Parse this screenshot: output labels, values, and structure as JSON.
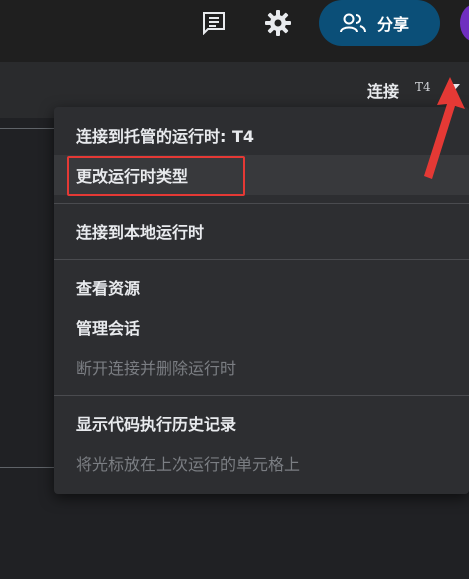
{
  "toolbar": {
    "comment_icon": "comment-icon",
    "settings_icon": "gear-icon",
    "share_label": "分享",
    "share_icon": "people-icon"
  },
  "runtime": {
    "connect_label": "连接",
    "runtime_type": "T4"
  },
  "menu": {
    "items": [
      {
        "label": "连接到托管的运行时: T4",
        "enabled": true
      },
      {
        "label": "更改运行时类型",
        "enabled": true,
        "highlighted": true
      },
      {
        "label": "连接到本地运行时",
        "enabled": true
      },
      {
        "label": "查看资源",
        "enabled": true
      },
      {
        "label": "管理会话",
        "enabled": true
      },
      {
        "label": "断开连接并删除运行时",
        "enabled": false
      },
      {
        "label": "显示代码执行历史记录",
        "enabled": true
      },
      {
        "label": "将光标放在上次运行的单元格上",
        "enabled": false
      }
    ]
  },
  "colors": {
    "annotation": "#e53935",
    "share_button": "#0b4f78"
  }
}
